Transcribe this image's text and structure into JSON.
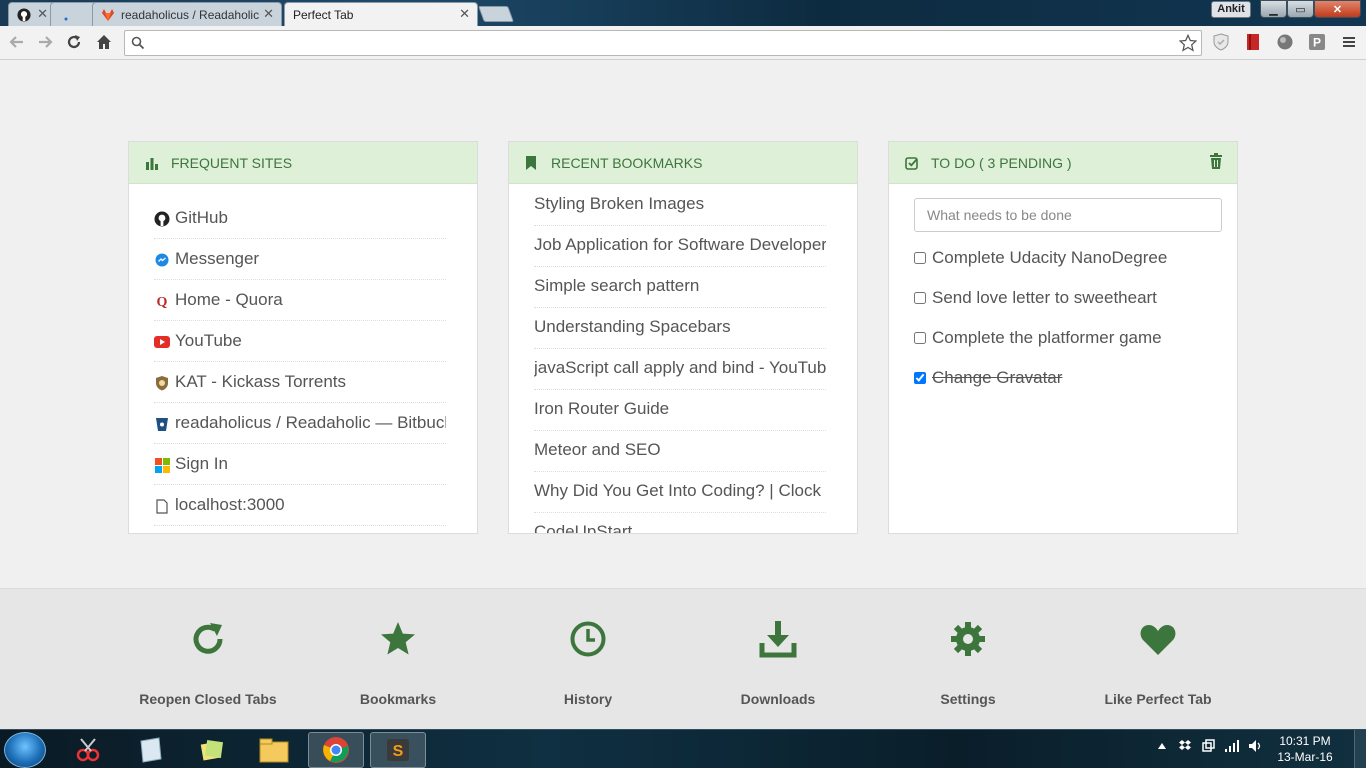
{
  "browser": {
    "tabs": [
      {
        "title": "",
        "icon": "github-icon"
      },
      {
        "title": "",
        "icon": "loading-icon"
      },
      {
        "title": "readaholicus / Readaholic",
        "icon": "gitlab-icon"
      },
      {
        "title": "Perfect Tab",
        "icon": "",
        "active": true
      }
    ],
    "user": "Ankit",
    "address_value": "",
    "window_controls": [
      "minimize",
      "maximize",
      "close"
    ]
  },
  "frequent_sites": {
    "title": "FREQUENT SITES",
    "items": [
      {
        "label": "GitHub",
        "icon": "github-icon"
      },
      {
        "label": "Messenger",
        "icon": "messenger-icon"
      },
      {
        "label": "Home - Quora",
        "icon": "quora-icon"
      },
      {
        "label": "YouTube",
        "icon": "youtube-icon"
      },
      {
        "label": "KAT - Kickass Torrents",
        "icon": "kat-icon"
      },
      {
        "label": "readaholicus / Readaholic — Bitbucket",
        "icon": "bitbucket-icon"
      },
      {
        "label": "Sign In",
        "icon": "microsoft-icon"
      },
      {
        "label": "localhost:3000",
        "icon": "file-icon"
      }
    ]
  },
  "recent_bookmarks": {
    "title": "RECENT BOOKMARKS",
    "items": [
      "Styling Broken Images",
      "Job Application for Software Developer",
      "Simple search pattern",
      "Understanding Spacebars",
      "javaScript call apply and bind - YouTube",
      "Iron Router Guide",
      "Meteor and SEO",
      "Why Did You Get Into Coding? | Clock",
      "CodeUpStart"
    ]
  },
  "todo": {
    "title": "TO DO ( 3 PENDING )",
    "placeholder": "What needs to be done",
    "items": [
      {
        "label": "Complete Udacity NanoDegree",
        "done": false
      },
      {
        "label": "Send love letter to sweetheart",
        "done": false
      },
      {
        "label": "Complete the platformer game",
        "done": false
      },
      {
        "label": "Change Gravatar",
        "done": true
      }
    ]
  },
  "quick_links": [
    {
      "label": "Reopen Closed Tabs",
      "icon": "refresh-icon"
    },
    {
      "label": "Bookmarks",
      "icon": "star-icon"
    },
    {
      "label": "History",
      "icon": "clock-icon"
    },
    {
      "label": "Downloads",
      "icon": "download-icon"
    },
    {
      "label": "Settings",
      "icon": "gear-icon"
    },
    {
      "label": "Like Perfect Tab",
      "icon": "heart-icon"
    }
  ],
  "colors": {
    "accent": "#3c763d",
    "header_bg": "#dff0d8"
  },
  "taskbar": {
    "time": "10:31 PM",
    "date": "13-Mar-16"
  }
}
